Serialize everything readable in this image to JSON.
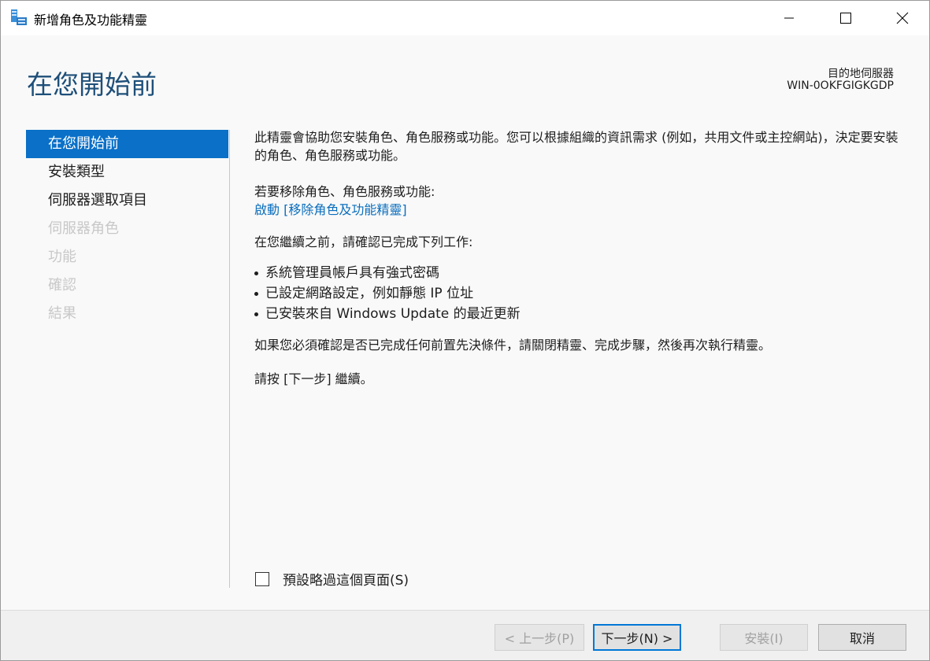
{
  "window": {
    "title": "新增角色及功能精靈",
    "icon": "server-manager-icon"
  },
  "header": {
    "page_title": "在您開始前",
    "destination_label": "目的地伺服器",
    "destination_server": "WIN-0OKFGIGKGDP"
  },
  "nav": {
    "items": [
      {
        "label": "在您開始前",
        "state": "active"
      },
      {
        "label": "安裝類型",
        "state": "enabled"
      },
      {
        "label": "伺服器選取項目",
        "state": "enabled"
      },
      {
        "label": "伺服器角色",
        "state": "disabled"
      },
      {
        "label": "功能",
        "state": "disabled"
      },
      {
        "label": "確認",
        "state": "disabled"
      },
      {
        "label": "結果",
        "state": "disabled"
      }
    ]
  },
  "content": {
    "intro": "此精靈會協助您安裝角色、角色服務或功能。您可以根據組織的資訊需求 (例如，共用文件或主控網站)，決定要安裝的角色、角色服務或功能。",
    "remove_label": "若要移除角色、角色服務或功能:",
    "remove_link": "啟動 [移除角色及功能精靈]",
    "before_label": "在您繼續之前，請確認已完成下列工作:",
    "bullets": [
      "系統管理員帳戶具有強式密碼",
      "已設定網路設定，例如靜態 IP 位址",
      "已安裝來自 Windows Update 的最近更新"
    ],
    "if_need": "如果您必須確認是否已完成任何前置先決條件，請關閉精靈、完成步驟，然後再次執行精靈。",
    "click_next": "請按 [下一步] 繼續。"
  },
  "skip_checkbox": {
    "label": "預設略過這個頁面(S)",
    "checked": false
  },
  "footer": {
    "prev_label": "< 上一步(P)",
    "next_label": "下一步(N) >",
    "install_label": "安裝(I)",
    "cancel_label": "取消"
  },
  "colors": {
    "accent": "#0a70c8",
    "title": "#1e4f79",
    "link": "#0a6ebd",
    "disabled_text": "#c8c8c8"
  }
}
